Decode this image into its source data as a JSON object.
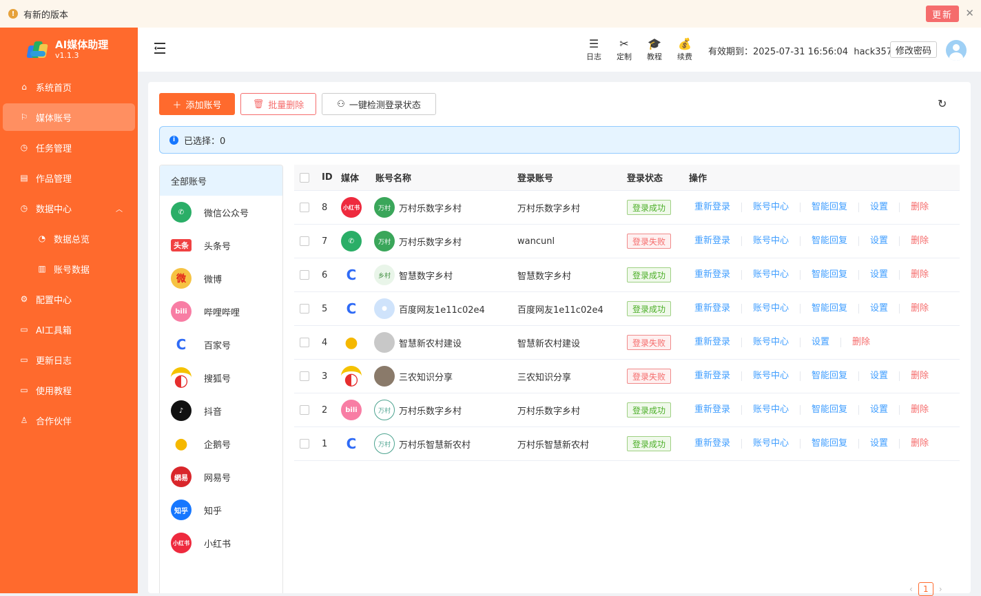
{
  "notice": {
    "text": "有新的版本",
    "update_label": "更新",
    "close_icon": "close-icon"
  },
  "app": {
    "title": "AI媒体助理",
    "version": "v1.1.3"
  },
  "sidebar": {
    "items": [
      {
        "label": "系统首页",
        "icon": "home-icon"
      },
      {
        "label": "媒体账号",
        "icon": "flag-icon",
        "active": true
      },
      {
        "label": "任务管理",
        "icon": "clock-icon"
      },
      {
        "label": "作品管理",
        "icon": "document-icon"
      },
      {
        "label": "数据中心",
        "icon": "clock-icon",
        "expanded": true
      },
      {
        "label": "数据总览",
        "icon": "pie-chart-icon",
        "sub": true
      },
      {
        "label": "账号数据",
        "icon": "bar-chart-icon",
        "sub": true
      },
      {
        "label": "配置中心",
        "icon": "gear-icon"
      },
      {
        "label": "AI工具箱",
        "icon": "book-icon"
      },
      {
        "label": "更新日志",
        "icon": "book-icon"
      },
      {
        "label": "使用教程",
        "icon": "monitor-icon"
      },
      {
        "label": "合作伙伴",
        "icon": "user-icon"
      }
    ]
  },
  "header": {
    "tools": [
      {
        "label": "日志",
        "icon": "database-icon"
      },
      {
        "label": "定制",
        "icon": "tools-icon"
      },
      {
        "label": "教程",
        "icon": "graduation-cap-icon"
      },
      {
        "label": "续费",
        "icon": "money-bag-icon"
      }
    ],
    "expiry": "有效期到：2025-07-31 16:56:04",
    "username": "hack357",
    "change_password": "修改密码"
  },
  "toolbar": {
    "add_label": "添加账号",
    "batch_delete_label": "批量删除",
    "check_label": "一键检测登录状态"
  },
  "alert": {
    "text": "已选择：0"
  },
  "platforms": {
    "all_label": "全部账号",
    "items": [
      {
        "name": "微信公众号",
        "logo": "wechat",
        "color": "#2aae67"
      },
      {
        "name": "头条号",
        "logo": "toutiao",
        "color": "#f04142"
      },
      {
        "name": "微博",
        "logo": "weibo",
        "color": "#f6c343"
      },
      {
        "name": "哔哩哔哩",
        "logo": "bilibili",
        "color": "#f87da4"
      },
      {
        "name": "百家号",
        "logo": "baijiahao",
        "color": "#2f6bf6"
      },
      {
        "name": "搜狐号",
        "logo": "sohu",
        "color": "#f5c200"
      },
      {
        "name": "抖音",
        "logo": "douyin",
        "color": "#111111"
      },
      {
        "name": "企鹅号",
        "logo": "qie",
        "color": "#f5b800"
      },
      {
        "name": "网易号",
        "logo": "netease",
        "color": "#d9262b"
      },
      {
        "name": "知乎",
        "logo": "zhihu",
        "color": "#1677ff"
      },
      {
        "name": "小红书",
        "logo": "xiaohongshu",
        "color": "#ee2a3e"
      }
    ]
  },
  "table": {
    "headers": {
      "id": "ID",
      "media": "媒体",
      "name": "账号名称",
      "login": "登录账号",
      "status": "登录状态",
      "ops": "操作"
    },
    "ops": {
      "relogin": "重新登录",
      "center": "账号中心",
      "reply": "智能回复",
      "settings": "设置",
      "delete": "删除"
    },
    "rows": [
      {
        "id": "8",
        "media": "xiaohongshu",
        "name": "万村乐数字乡村",
        "login": "万村乐数字乡村",
        "status": "登录成功",
        "ok": true,
        "reply": true,
        "avatar": "village"
      },
      {
        "id": "7",
        "media": "wechat",
        "name": "万村乐数字乡村",
        "login": "wancunl",
        "status": "登录失败",
        "ok": false,
        "reply": true,
        "avatar": "village"
      },
      {
        "id": "6",
        "media": "baijiahao",
        "name": "智慧数字乡村",
        "login": "智慧数字乡村",
        "status": "登录成功",
        "ok": true,
        "reply": true,
        "avatar": "smart"
      },
      {
        "id": "5",
        "media": "baijiahao",
        "name": "百度网友1e11c02e4",
        "login": "百度网友1e11c02e4",
        "status": "登录成功",
        "ok": true,
        "reply": true,
        "avatar": "default-blue"
      },
      {
        "id": "4",
        "media": "qie",
        "name": "智慧新农村建设",
        "login": "智慧新农村建设",
        "status": "登录失败",
        "ok": false,
        "reply": false,
        "avatar": "grey"
      },
      {
        "id": "3",
        "media": "sohu",
        "name": "三农知识分享",
        "login": "三农知识分享",
        "status": "登录失败",
        "ok": false,
        "reply": true,
        "avatar": "photo"
      },
      {
        "id": "2",
        "media": "bilibili",
        "name": "万村乐数字乡村",
        "login": "万村乐数字乡村",
        "status": "登录成功",
        "ok": true,
        "reply": true,
        "avatar": "village-outline"
      },
      {
        "id": "1",
        "media": "baijiahao",
        "name": "万村乐智慧新农村",
        "login": "万村乐智慧新农村",
        "status": "登录成功",
        "ok": true,
        "reply": true,
        "avatar": "village-outline"
      }
    ]
  },
  "pagination": {
    "current": "1"
  }
}
